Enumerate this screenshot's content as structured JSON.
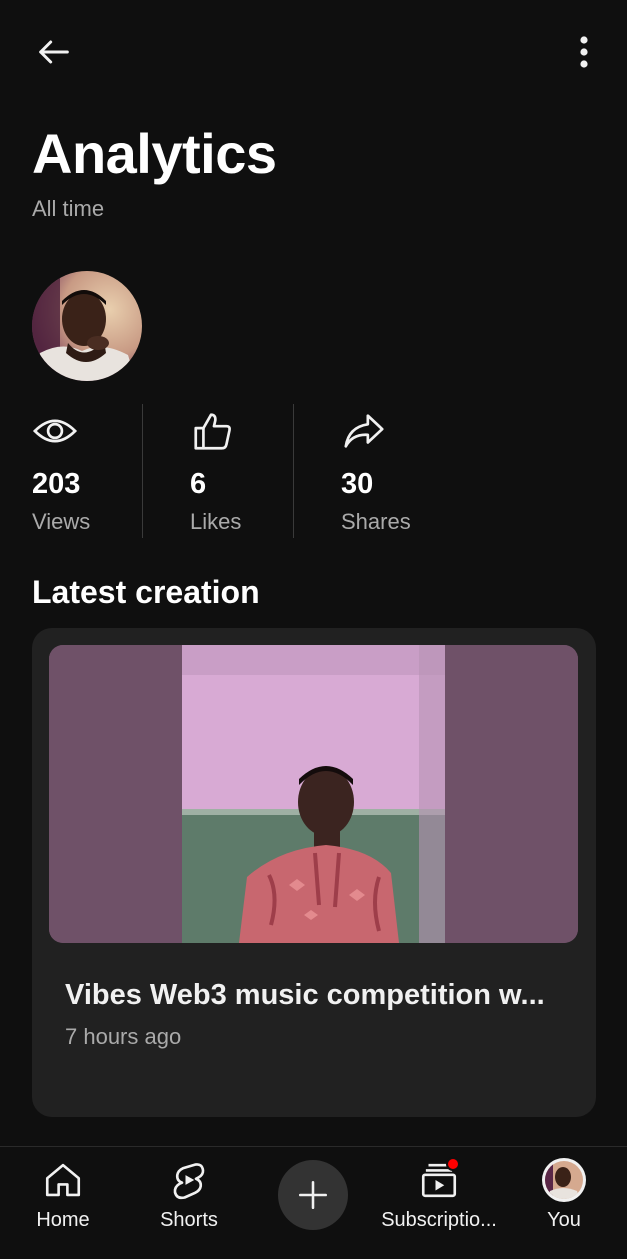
{
  "header": {
    "title": "Analytics",
    "subtitle": "All time",
    "back_icon": "arrow-left-icon",
    "more_icon": "more-vertical-icon"
  },
  "stats": [
    {
      "icon": "eye-icon",
      "value": "203",
      "label": "Views"
    },
    {
      "icon": "thumbs-up-icon",
      "value": "6",
      "label": "Likes"
    },
    {
      "icon": "share-icon",
      "value": "30",
      "label": "Shares"
    }
  ],
  "latest": {
    "section_title": "Latest creation",
    "video_title": "Vibes Web3 music competition w...",
    "time": "7 hours ago"
  },
  "bottom_nav": {
    "items": [
      {
        "label": "Home",
        "icon": "home-icon"
      },
      {
        "label": "Shorts",
        "icon": "shorts-icon"
      },
      {
        "label": "",
        "icon": "plus-icon"
      },
      {
        "label": "Subscriptio...",
        "icon": "subscriptions-icon"
      },
      {
        "label": "You",
        "icon": "avatar-icon"
      }
    ]
  },
  "colors": {
    "background": "#0f0f0f",
    "card": "#212121",
    "text_primary": "#f1f1f1",
    "text_secondary": "#aaaaaa",
    "notification": "#ff0000"
  }
}
